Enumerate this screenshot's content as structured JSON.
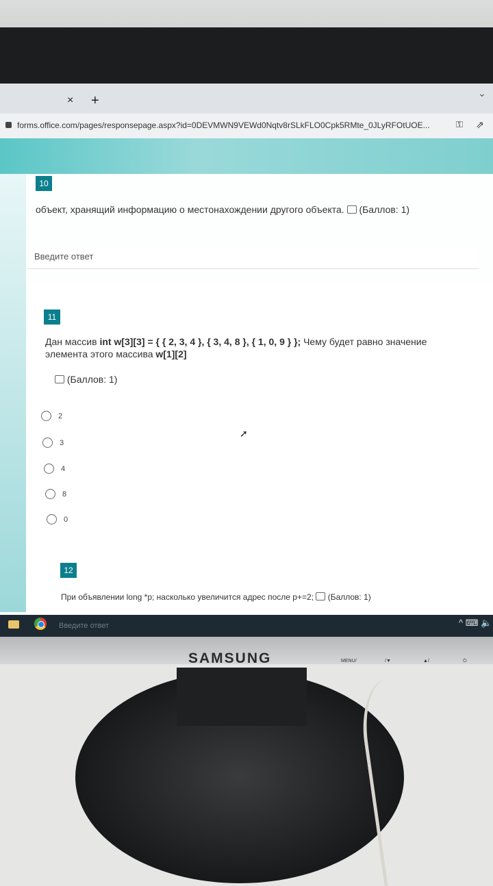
{
  "browser": {
    "tab_close": "×",
    "tab_new": "+",
    "url": "forms.office.com/pages/responsepage.aspx?id=0DEVMWN9VEWd0Nqtv8rSLkFLO0Cpk5RMte_0JLyRFOtUOE..."
  },
  "questions": [
    {
      "number": "10",
      "text": "объект, хранящий информацию о местонахождении другого объекта.",
      "points": "(Баллов: 1)",
      "answer_placeholder": "Введите ответ"
    },
    {
      "number": "11",
      "text_prefix": "Дан массив ",
      "code1": "int w[3][3] = { { 2, 3, 4 }, { 3, 4, 8 }, { 1, 0, 9 } };",
      "text_mid": " Чему будет равно значение элемента этого массива ",
      "code2": "w[1][2]",
      "points": "(Баллов: 1)",
      "options": [
        "2",
        "3",
        "4",
        "8",
        "0"
      ]
    },
    {
      "number": "12",
      "text": "При объявлении long *p; насколько увеличится адрес после p+=2;",
      "points": "(Баллов: 1)"
    }
  ],
  "taskbar": {
    "ghost_text": "Введите ответ"
  },
  "monitor": {
    "brand": "SAMSUNG",
    "buttons": [
      "MENU/",
      "/▼",
      "▲/",
      "⏻"
    ]
  }
}
